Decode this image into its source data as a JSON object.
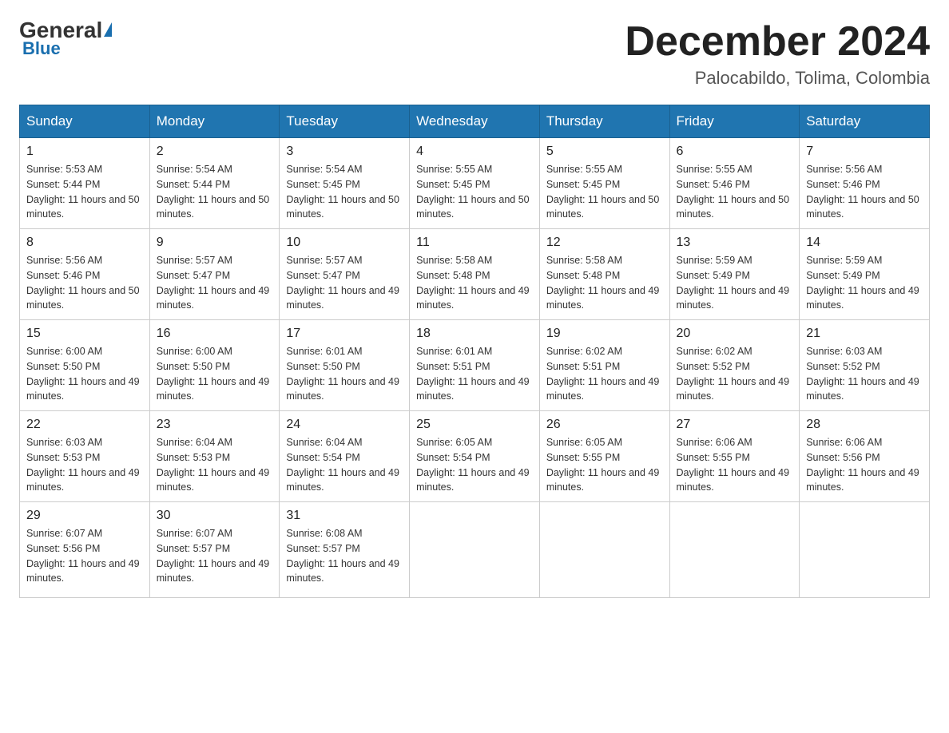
{
  "header": {
    "logo_general": "General",
    "logo_blue": "Blue",
    "month_title": "December 2024",
    "location": "Palocabildo, Tolima, Colombia"
  },
  "days_of_week": [
    "Sunday",
    "Monday",
    "Tuesday",
    "Wednesday",
    "Thursday",
    "Friday",
    "Saturday"
  ],
  "weeks": [
    [
      {
        "day": "1",
        "sunrise": "5:53 AM",
        "sunset": "5:44 PM",
        "daylight": "11 hours and 50 minutes."
      },
      {
        "day": "2",
        "sunrise": "5:54 AM",
        "sunset": "5:44 PM",
        "daylight": "11 hours and 50 minutes."
      },
      {
        "day": "3",
        "sunrise": "5:54 AM",
        "sunset": "5:45 PM",
        "daylight": "11 hours and 50 minutes."
      },
      {
        "day": "4",
        "sunrise": "5:55 AM",
        "sunset": "5:45 PM",
        "daylight": "11 hours and 50 minutes."
      },
      {
        "day": "5",
        "sunrise": "5:55 AM",
        "sunset": "5:45 PM",
        "daylight": "11 hours and 50 minutes."
      },
      {
        "day": "6",
        "sunrise": "5:55 AM",
        "sunset": "5:46 PM",
        "daylight": "11 hours and 50 minutes."
      },
      {
        "day": "7",
        "sunrise": "5:56 AM",
        "sunset": "5:46 PM",
        "daylight": "11 hours and 50 minutes."
      }
    ],
    [
      {
        "day": "8",
        "sunrise": "5:56 AM",
        "sunset": "5:46 PM",
        "daylight": "11 hours and 50 minutes."
      },
      {
        "day": "9",
        "sunrise": "5:57 AM",
        "sunset": "5:47 PM",
        "daylight": "11 hours and 49 minutes."
      },
      {
        "day": "10",
        "sunrise": "5:57 AM",
        "sunset": "5:47 PM",
        "daylight": "11 hours and 49 minutes."
      },
      {
        "day": "11",
        "sunrise": "5:58 AM",
        "sunset": "5:48 PM",
        "daylight": "11 hours and 49 minutes."
      },
      {
        "day": "12",
        "sunrise": "5:58 AM",
        "sunset": "5:48 PM",
        "daylight": "11 hours and 49 minutes."
      },
      {
        "day": "13",
        "sunrise": "5:59 AM",
        "sunset": "5:49 PM",
        "daylight": "11 hours and 49 minutes."
      },
      {
        "day": "14",
        "sunrise": "5:59 AM",
        "sunset": "5:49 PM",
        "daylight": "11 hours and 49 minutes."
      }
    ],
    [
      {
        "day": "15",
        "sunrise": "6:00 AM",
        "sunset": "5:50 PM",
        "daylight": "11 hours and 49 minutes."
      },
      {
        "day": "16",
        "sunrise": "6:00 AM",
        "sunset": "5:50 PM",
        "daylight": "11 hours and 49 minutes."
      },
      {
        "day": "17",
        "sunrise": "6:01 AM",
        "sunset": "5:50 PM",
        "daylight": "11 hours and 49 minutes."
      },
      {
        "day": "18",
        "sunrise": "6:01 AM",
        "sunset": "5:51 PM",
        "daylight": "11 hours and 49 minutes."
      },
      {
        "day": "19",
        "sunrise": "6:02 AM",
        "sunset": "5:51 PM",
        "daylight": "11 hours and 49 minutes."
      },
      {
        "day": "20",
        "sunrise": "6:02 AM",
        "sunset": "5:52 PM",
        "daylight": "11 hours and 49 minutes."
      },
      {
        "day": "21",
        "sunrise": "6:03 AM",
        "sunset": "5:52 PM",
        "daylight": "11 hours and 49 minutes."
      }
    ],
    [
      {
        "day": "22",
        "sunrise": "6:03 AM",
        "sunset": "5:53 PM",
        "daylight": "11 hours and 49 minutes."
      },
      {
        "day": "23",
        "sunrise": "6:04 AM",
        "sunset": "5:53 PM",
        "daylight": "11 hours and 49 minutes."
      },
      {
        "day": "24",
        "sunrise": "6:04 AM",
        "sunset": "5:54 PM",
        "daylight": "11 hours and 49 minutes."
      },
      {
        "day": "25",
        "sunrise": "6:05 AM",
        "sunset": "5:54 PM",
        "daylight": "11 hours and 49 minutes."
      },
      {
        "day": "26",
        "sunrise": "6:05 AM",
        "sunset": "5:55 PM",
        "daylight": "11 hours and 49 minutes."
      },
      {
        "day": "27",
        "sunrise": "6:06 AM",
        "sunset": "5:55 PM",
        "daylight": "11 hours and 49 minutes."
      },
      {
        "day": "28",
        "sunrise": "6:06 AM",
        "sunset": "5:56 PM",
        "daylight": "11 hours and 49 minutes."
      }
    ],
    [
      {
        "day": "29",
        "sunrise": "6:07 AM",
        "sunset": "5:56 PM",
        "daylight": "11 hours and 49 minutes."
      },
      {
        "day": "30",
        "sunrise": "6:07 AM",
        "sunset": "5:57 PM",
        "daylight": "11 hours and 49 minutes."
      },
      {
        "day": "31",
        "sunrise": "6:08 AM",
        "sunset": "5:57 PM",
        "daylight": "11 hours and 49 minutes."
      },
      null,
      null,
      null,
      null
    ]
  ]
}
